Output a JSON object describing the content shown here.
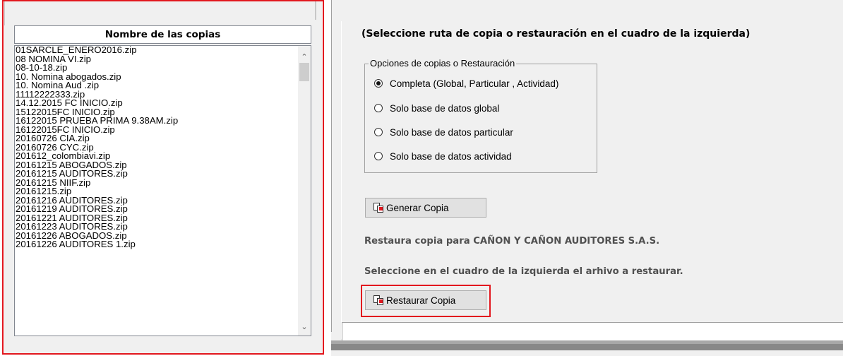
{
  "file_list": {
    "header": "Nombre de las copias",
    "items": [
      "01SARCLE_ENERO2016.zip",
      "08 NOMINA VI.zip",
      "08-10-18.zip",
      "10. Nomina abogados.zip",
      "10. Nomina Aud .zip",
      "11112222333.zip",
      "14.12.2015 FC INICIO.zip",
      "15122015FC INICIO.zip",
      "16122015 PRUEBA PRIMA 9.38AM.zip",
      "16122015FC INICIO.zip",
      "20160726 CIA.zip",
      "20160726 CYC.zip",
      "201612_colombiavi.zip",
      "20161215 ABOGADOS.zip",
      "20161215 AUDITORES.zip",
      "20161215 NIIF.zip",
      "20161215.zip",
      "20161216 AUDITORES.zip",
      "20161219 AUDITORES.zip",
      "20161221 AUDITORES.zip",
      "20161223 AUDITORES.zip",
      "20161226 ABOGADOS.zip",
      "20161226 AUDITORES 1.zip"
    ],
    "scroll_up_icon": "chevron-up-icon",
    "scroll_down_icon": "chevron-down-icon"
  },
  "instruction": "(Seleccione ruta de copia o restauración en el cuadro de la izquierda)",
  "options": {
    "legend": "Opciones de copias o Restauración",
    "selected_index": 0,
    "items": [
      "Completa (Global, Particular , Actividad)",
      "Solo base de datos global",
      "Solo base de datos particular",
      "Solo base de datos actividad"
    ]
  },
  "buttons": {
    "generar": "Generar Copia",
    "restaurar": "Restaurar Copia",
    "icon": "copy-document-icon"
  },
  "info": {
    "restaura": "Restaura copia para CAÑON Y CAÑON  AUDITORES S.A.S.",
    "seleccione": "Seleccione en el cuadro de la izquierda el arhivo a restaurar."
  },
  "colors": {
    "highlight": "#e2171e",
    "window_bg": "#f0f0f0",
    "button_bg": "#e1e1e1"
  }
}
